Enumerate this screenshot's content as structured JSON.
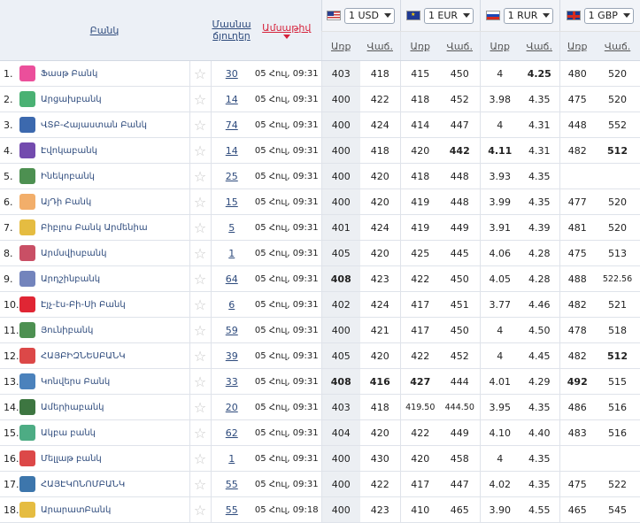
{
  "header": {
    "bank_col": "Բանկ",
    "branches_col_line1": "Մասնա",
    "branches_col_line2": "ճյուղեր",
    "date_col": "Ամսաթիվ",
    "currencies": [
      {
        "code": "USD",
        "label": "1 USD",
        "flag": "flag-us"
      },
      {
        "code": "EUR",
        "label": "1 EUR",
        "flag": "flag-eu"
      },
      {
        "code": "RUR",
        "label": "1 RUR",
        "flag": "flag-ru"
      },
      {
        "code": "GBP",
        "label": "1 GBP",
        "flag": "flag-gb"
      }
    ],
    "buy_label": "Առք",
    "sell_label": "Վաճ."
  },
  "rows": [
    {
      "n": "1.",
      "bank": "Ֆասթ Բանկ",
      "logo": "fast-bank-logo",
      "color": "#e8308a",
      "branches": "30",
      "date": "05 Հուլ, 09:31",
      "usd": [
        "403",
        "418"
      ],
      "eur": [
        "415",
        "450"
      ],
      "rur": [
        "4",
        "4.25"
      ],
      "gbp": [
        "480",
        "520"
      ],
      "bold": [
        "rur_s"
      ]
    },
    {
      "n": "2.",
      "bank": "Արցախբանկ",
      "logo": "artsakhbank-logo",
      "color": "#2aa35a",
      "branches": "14",
      "date": "05 Հուլ, 09:31",
      "usd": [
        "400",
        "422"
      ],
      "eur": [
        "418",
        "452"
      ],
      "rur": [
        "3.98",
        "4.35"
      ],
      "gbp": [
        "475",
        "520"
      ],
      "bold": []
    },
    {
      "n": "3.",
      "bank": "ՎՏԲ-Հայաստան Բանկ",
      "logo": "vtb-logo",
      "color": "#1a4fa0",
      "branches": "74",
      "date": "05 Հուլ, 09:31",
      "usd": [
        "400",
        "424"
      ],
      "eur": [
        "414",
        "447"
      ],
      "rur": [
        "4",
        "4.31"
      ],
      "gbp": [
        "448",
        "552"
      ],
      "bold": []
    },
    {
      "n": "4.",
      "bank": "Էվոկաբանկ",
      "logo": "evocabank-logo",
      "color": "#5a2ca0",
      "branches": "14",
      "date": "05 Հուլ, 09:31",
      "usd": [
        "400",
        "418"
      ],
      "eur": [
        "420",
        "442"
      ],
      "rur": [
        "4.11",
        "4.31"
      ],
      "gbp": [
        "482",
        "512"
      ],
      "bold": [
        "eur_s",
        "rur_b",
        "gbp_s"
      ]
    },
    {
      "n": "5.",
      "bank": "Ինեկոբանկ",
      "logo": "inecobank-logo",
      "color": "#2e7d32",
      "branches": "25",
      "date": "05 Հուլ, 09:31",
      "usd": [
        "400",
        "420"
      ],
      "eur": [
        "418",
        "448"
      ],
      "rur": [
        "3.93",
        "4.35"
      ],
      "gbp": [
        "",
        ""
      ],
      "bold": []
    },
    {
      "n": "6.",
      "bank": "ԱյԴի Բանկ",
      "logo": "idbank-logo",
      "color": "#f0a050",
      "branches": "15",
      "date": "05 Հուլ, 09:31",
      "usd": [
        "400",
        "420"
      ],
      "eur": [
        "419",
        "448"
      ],
      "rur": [
        "3.99",
        "4.35"
      ],
      "gbp": [
        "477",
        "520"
      ],
      "bold": []
    },
    {
      "n": "7.",
      "bank": "Բիբլոս Բանկ Արմենիա",
      "logo": "byblos-logo",
      "color": "#e0b020",
      "branches": "5",
      "date": "05 Հուլ, 09:31",
      "usd": [
        "401",
        "424"
      ],
      "eur": [
        "419",
        "449"
      ],
      "rur": [
        "3.91",
        "4.39"
      ],
      "gbp": [
        "481",
        "520"
      ],
      "bold": []
    },
    {
      "n": "8.",
      "bank": "Արմսվիսբանկ",
      "logo": "armswissbank-logo",
      "color": "#c0304a",
      "branches": "1",
      "date": "05 Հուլ, 09:31",
      "usd": [
        "405",
        "420"
      ],
      "eur": [
        "425",
        "445"
      ],
      "rur": [
        "4.06",
        "4.28"
      ],
      "gbp": [
        "475",
        "513"
      ],
      "bold": []
    },
    {
      "n": "9.",
      "bank": "Արդշինբանկ",
      "logo": "ardshinbank-logo",
      "color": "#5a6fb0",
      "branches": "64",
      "date": "05 Հուլ, 09:31",
      "usd": [
        "408",
        "423"
      ],
      "eur": [
        "422",
        "450"
      ],
      "rur": [
        "4.05",
        "4.28"
      ],
      "gbp": [
        "488",
        "522.56"
      ],
      "bold": [
        "usd_b"
      ]
    },
    {
      "n": "10.",
      "bank": "Էյչ-էս-Բի-Սի Բանկ",
      "logo": "hsbc-logo",
      "color": "#db0011",
      "branches": "6",
      "date": "05 Հուլ, 09:31",
      "usd": [
        "402",
        "424"
      ],
      "eur": [
        "417",
        "451"
      ],
      "rur": [
        "3.77",
        "4.46"
      ],
      "gbp": [
        "482",
        "521"
      ],
      "bold": []
    },
    {
      "n": "11.",
      "bank": "Յունիբանկ",
      "logo": "unibank-logo",
      "color": "#2e7d32",
      "branches": "59",
      "date": "05 Հուլ, 09:31",
      "usd": [
        "400",
        "421"
      ],
      "eur": [
        "417",
        "450"
      ],
      "rur": [
        "4",
        "4.50"
      ],
      "gbp": [
        "478",
        "518"
      ],
      "bold": []
    },
    {
      "n": "12.",
      "bank": "ՀԱՅԲԻԶՆԵՍԲԱՆԿ",
      "logo": "armbusinessbank-logo",
      "color": "#d62828",
      "branches": "39",
      "date": "05 Հուլ, 09:31",
      "usd": [
        "405",
        "420"
      ],
      "eur": [
        "422",
        "452"
      ],
      "rur": [
        "4",
        "4.45"
      ],
      "gbp": [
        "482",
        "512"
      ],
      "bold": [
        "gbp_s"
      ]
    },
    {
      "n": "13.",
      "bank": "Կոնվերս Բանկ",
      "logo": "conversebank-logo",
      "color": "#2b6cb0",
      "branches": "33",
      "date": "05 Հուլ, 09:31",
      "usd": [
        "408",
        "416"
      ],
      "eur": [
        "427",
        "444"
      ],
      "rur": [
        "4.01",
        "4.29"
      ],
      "gbp": [
        "492",
        "515"
      ],
      "bold": [
        "usd_b",
        "usd_s",
        "eur_b",
        "gbp_b"
      ]
    },
    {
      "n": "14.",
      "bank": "Ամերիաբանկ",
      "logo": "ameriabank-logo",
      "color": "#1b5e20",
      "branches": "20",
      "date": "05 Հուլ, 09:31",
      "usd": [
        "403",
        "418"
      ],
      "eur": [
        "419.50",
        "444.50"
      ],
      "rur": [
        "3.95",
        "4.35"
      ],
      "gbp": [
        "486",
        "516"
      ],
      "bold": []
    },
    {
      "n": "15.",
      "bank": "Ակբա բանկ",
      "logo": "acba-logo",
      "color": "#2e9e6e",
      "branches": "62",
      "date": "05 Հուլ, 09:31",
      "usd": [
        "404",
        "420"
      ],
      "eur": [
        "422",
        "449"
      ],
      "rur": [
        "4.10",
        "4.40"
      ],
      "gbp": [
        "483",
        "516"
      ],
      "bold": []
    },
    {
      "n": "16.",
      "bank": "Մելլաթ բանկ",
      "logo": "mellat-logo",
      "color": "#d62828",
      "branches": "1",
      "date": "05 Հուլ, 09:31",
      "usd": [
        "400",
        "430"
      ],
      "eur": [
        "420",
        "458"
      ],
      "rur": [
        "4",
        "4.35"
      ],
      "gbp": [
        "",
        ""
      ],
      "bold": []
    },
    {
      "n": "17.",
      "bank": "ՀԱՅԷԿՈՆՈՄԲԱՆԿ",
      "logo": "aeb-logo",
      "color": "#1b5e9e",
      "branches": "55",
      "date": "05 Հուլ, 09:31",
      "usd": [
        "400",
        "422"
      ],
      "eur": [
        "417",
        "447"
      ],
      "rur": [
        "4.02",
        "4.35"
      ],
      "gbp": [
        "475",
        "522"
      ],
      "bold": []
    },
    {
      "n": "18.",
      "bank": "ԱրարատԲանկ",
      "logo": "araratbank-logo",
      "color": "#e0b020",
      "branches": "55",
      "date": "05 Հուլ, 09:18",
      "usd": [
        "400",
        "423"
      ],
      "eur": [
        "410",
        "465"
      ],
      "rur": [
        "3.90",
        "4.55"
      ],
      "gbp": [
        "465",
        "545"
      ],
      "bold": []
    }
  ]
}
